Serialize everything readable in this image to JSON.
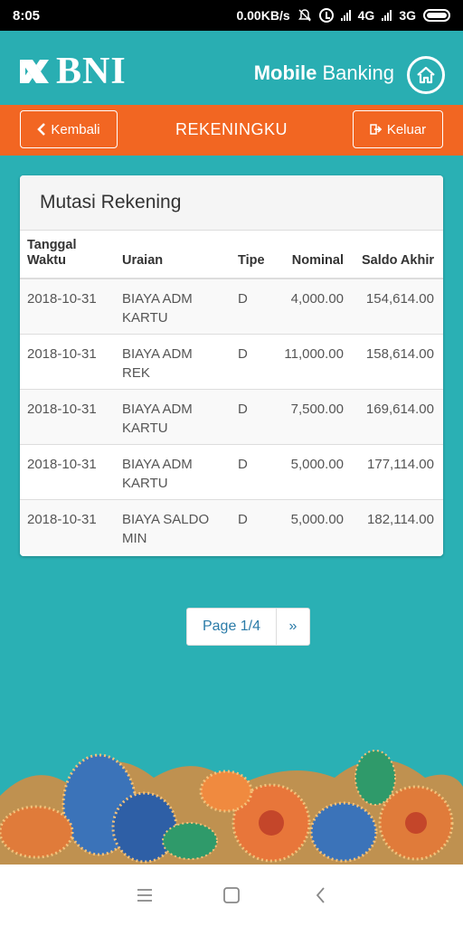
{
  "status_bar": {
    "time": "8:05",
    "network_speed": "0.00KB/s",
    "network_1": "4G",
    "network_2": "3G"
  },
  "header": {
    "logo_text": "BNI",
    "title_bold": "Mobile",
    "title_rest": "Banking",
    "home_icon": "home-icon"
  },
  "nav": {
    "back_label": "Kembali",
    "title": "REKENINGKU",
    "exit_label": "Keluar"
  },
  "card": {
    "title": "Mutasi Rekening",
    "columns": {
      "date_line1": "Tanggal",
      "date_line2": "Waktu",
      "description": "Uraian",
      "type": "Tipe",
      "amount": "Nominal",
      "balance": "Saldo Akhir"
    },
    "rows": [
      {
        "date": "2018-10-31",
        "desc_1": "BIAYA ADM",
        "desc_2": "KARTU",
        "type": "D",
        "amount": "4,000.00",
        "balance": "154,614.00"
      },
      {
        "date": "2018-10-31",
        "desc_1": "BIAYA ADM",
        "desc_2": "REK",
        "type": "D",
        "amount": "11,000.00",
        "balance": "158,614.00"
      },
      {
        "date": "2018-10-31",
        "desc_1": "BIAYA ADM",
        "desc_2": "KARTU",
        "type": "D",
        "amount": "7,500.00",
        "balance": "169,614.00"
      },
      {
        "date": "2018-10-31",
        "desc_1": "BIAYA ADM",
        "desc_2": "KARTU",
        "type": "D",
        "amount": "5,000.00",
        "balance": "177,114.00"
      },
      {
        "date": "2018-10-31",
        "desc_1": "BIAYA SALDO",
        "desc_2": "MIN",
        "type": "D",
        "amount": "5,000.00",
        "balance": "182,114.00"
      }
    ]
  },
  "pagination": {
    "page_label": "Page 1/4",
    "next_label": "»"
  },
  "colors": {
    "teal_background": "#2ab0b4",
    "orange_nav": "#f26622",
    "link_blue": "#2a7ba8"
  }
}
